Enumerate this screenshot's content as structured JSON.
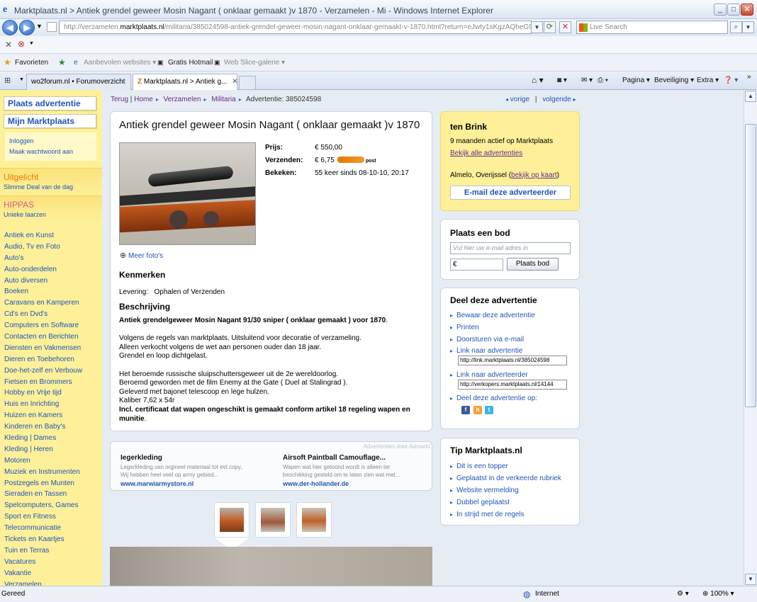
{
  "window": {
    "title": "Marktplaats.nl > Antiek grendel geweer Mosin Nagant ( onklaar gemaakt )v 1870 - Verzamelen - Mi - Windows Internet Explorer",
    "address": "http://verzamelen.marktplaats.nl/militaria/385024598-antiek-grendel-geweer-mosin-nagant-onklaar-gemaakt-v-1870.html?return=eJwty1sKgzAQheG9CPpoEu3N5",
    "address_domain": "marktplaats.nl",
    "address_prefix": "http://verzamelen.",
    "address_suffix": "/militaria/385024598-antiek-grendel-geweer-mosin-nagant-onklaar-gemaakt-v-1870.html?return=eJwty1sKgzAQheG9CPpoEu3N5",
    "search_placeholder": "Live Search"
  },
  "favorites": {
    "favorieten": "Favorieten",
    "aanbevolen": "Aanbevolen websites",
    "hotmail": "Gratis Hotmail",
    "webslice": "Web Slice-galerie"
  },
  "tabs": [
    {
      "label": "wo2forum.nl • Forumoverzicht"
    },
    {
      "label": "Marktplaats.nl > Antiek g..."
    }
  ],
  "commandbar": {
    "pagina": "Pagina",
    "beveiliging": "Beveiliging",
    "extra": "Extra"
  },
  "status": {
    "left": "Gereed",
    "zone": "Internet",
    "zoom": "100%"
  },
  "left": {
    "plaats": "Plaats advertentie",
    "mijn": "Mijn Marktplaats",
    "inloggen": "Inloggen",
    "wachtwoord": "Maak wachtwoord aan",
    "uitgelicht": "Uitgelicht",
    "uitgelicht_sub": "Slimme Deal van de dag",
    "hippas": "HIPPAS",
    "hippas_sub": "Unieke laarzen",
    "categories": [
      "Antiek en Kunst",
      "Audio, Tv en Foto",
      "Auto's",
      "Auto-onderdelen",
      "Auto diversen",
      "Boeken",
      "Caravans en Kamperen",
      "Cd's en Dvd's",
      "Computers en Software",
      "Contacten en Berichten",
      "Diensten en Vakmensen",
      "Dieren en Toebehoren",
      "Doe-het-zelf en Verbouw",
      "Fietsen en Brommers",
      "Hobby en Vrije tijd",
      "Huis en Inrichting",
      "Huizen en Kamers",
      "Kinderen en Baby's",
      "Kleding | Dames",
      "Kleding | Heren",
      "Motoren",
      "Muziek en Instrumenten",
      "Postzegels en Munten",
      "Sieraden en Tassen",
      "Spelcomputers, Games",
      "Sport en Fitness",
      "Telecommunicatie",
      "Tickets en Kaartjes",
      "Tuin en Terras",
      "Vacatures",
      "Vakantie",
      "Verzamelen"
    ]
  },
  "breadcrumb": {
    "terug": "Terug",
    "home": "Home",
    "verzamelen": "Verzamelen",
    "militaria": "Militaria",
    "advertentie": "Advertentie: 385024598"
  },
  "pager": {
    "vorige": "vorige",
    "volgende": "volgende"
  },
  "ad": {
    "title": "Antiek grendel geweer Mosin Nagant ( onklaar gemaakt )v 1870",
    "prijs_label": "Prijs:",
    "prijs": "€ 550,00",
    "verzenden_label": "Verzenden:",
    "verzenden": "€ 6,75",
    "post": "post",
    "bekeken_label": "Bekeken:",
    "bekeken": "55 keer sinds 08-10-10, 20:17",
    "meer_fotos": "Meer foto's",
    "kenmerken": "Kenmerken",
    "levering_label": "Levering:",
    "levering": "Ophalen of Verzenden",
    "beschrijving": "Beschrijving",
    "desc": {
      "l1": "Antiek grendelgeweer Mosin Nagant 91/30 sniper ( onklaar gemaakt ) voor 1870",
      "l2": "Volgens de regels van marktplaats. Uitsluitend voor decoratie of verzameling.",
      "l3": "Alleen verkocht volgens de wet aan personen ouder dan 18 jaar.",
      "l4": "Grendel en loop dichtgelast.",
      "l5": "Het beroemde russische sluipschuttersgeweer uit de 2e wereldoorlog.",
      "l6": "Beroemd geworden met de film Enemy at the Gate ( Duel at Stalingrad ).",
      "l7": "Geleverd met bajonet telescoop en lege hulzen.",
      "l8": "Kaliber 7,62 x 54r",
      "l9": "Incl. certificaat dat wapen ongeschikt is gemaakt conform artikel 18 regeling wapen en munitie"
    }
  },
  "ads": {
    "label": "Advertenties door Admarkt",
    "a1": {
      "h": "Iegerkleding",
      "b1": "Legerkleding,van orgineel materiaal tot evt.copy,",
      "b2": "Wij hebben heel veel op army gebied...",
      "u": "www.marwiarmystore.nl"
    },
    "a2": {
      "h": "Airsoft Paintball Camouflage...",
      "b1": "Wapen wat hier getoond wordt is alleen ter",
      "b2": "beschikking gesteld om te laten zien wat met...",
      "u": "www.der-hollander.de"
    }
  },
  "seller": {
    "name": "ten Brink",
    "active": "9 maanden actief op Marktplaats",
    "all": "Bekijk alle advertenties",
    "location": "Almelo, Overijssel",
    "map": "bekijk op kaart",
    "mail": "E-mail deze adverteerder"
  },
  "bid": {
    "title": "Plaats een bod",
    "email_placeholder": "Vul hier uw e-mail adres in",
    "currency": "€",
    "button": "Plaats bod"
  },
  "share": {
    "title": "Deel deze advertentie",
    "bewaar": "Bewaar deze advertentie",
    "printen": "Printen",
    "doorsturen": "Doorsturen via e-mail",
    "link_ad": "Link naar advertentie",
    "link_ad_val": "http://link.marktplaats.nl/385024598",
    "link_adv": "Link naar adverteerder",
    "link_adv_val": "http://verkopers.marktplaats.nl/14144",
    "deel": "Deel deze advertentie op:"
  },
  "tips": {
    "title": "Tip Marktplaats.nl",
    "items": [
      "Dit is een topper",
      "Geplaatst in de verkeerde rubriek",
      "Website vermelding",
      "Dubbel geplaatst",
      "In strijd met de regels"
    ]
  }
}
